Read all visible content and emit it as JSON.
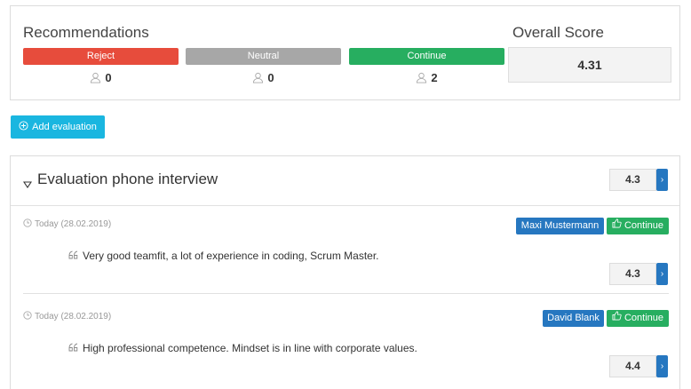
{
  "recommendations": {
    "title": "Recommendations",
    "reject_label": "Reject",
    "neutral_label": "Neutral",
    "continue_label": "Continue",
    "reject_count": "0",
    "neutral_count": "0",
    "continue_count": "2",
    "colors": {
      "reject": "#e74c3c",
      "neutral": "#a7a7a7",
      "continue": "#27ae60"
    }
  },
  "overall": {
    "title": "Overall Score",
    "score": "4.31"
  },
  "add_button": {
    "label": "Add evaluation",
    "icon": "plus-circle-icon",
    "color": "#1ab6e0"
  },
  "evaluation": {
    "title": "Evaluation phone interview",
    "score": "4.3",
    "entries": [
      {
        "date": "Today (28.02.2019)",
        "user": "Maxi Mustermann",
        "tag": "Continue",
        "text": "Very good teamfit, a lot of experience in coding, Scrum Master.",
        "score": "4.3"
      },
      {
        "date": "Today (28.02.2019)",
        "user": "David Blank",
        "tag": "Continue",
        "text": "High professional competence. Mindset is in line with corporate values.",
        "score": "4.4"
      }
    ]
  },
  "icons": {
    "chevron": "chevron-right-icon",
    "clock": "clock-icon",
    "quote": "quote-icon",
    "thumb": "thumbs-up-icon",
    "person": "person-icon",
    "triangle": "triangle-down-icon"
  }
}
